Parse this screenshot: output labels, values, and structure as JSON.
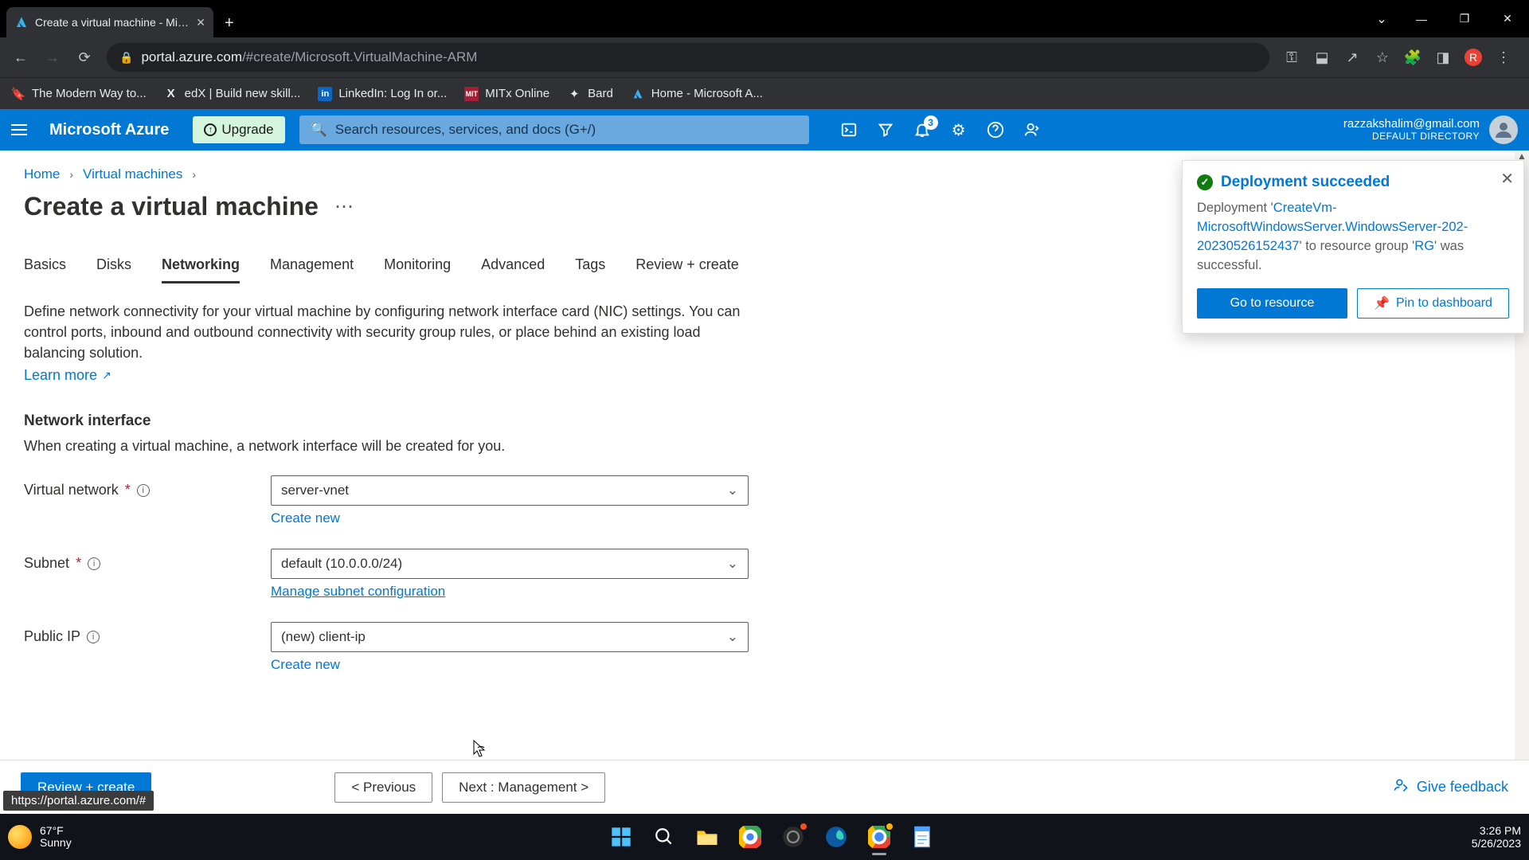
{
  "browser": {
    "tab_title": "Create a virtual machine - Micros",
    "url_host": "portal.azure.com",
    "url_path": "/#create/Microsoft.VirtualMachine-ARM",
    "bookmarks": [
      {
        "label": "The Modern Way to..."
      },
      {
        "label": "edX | Build new skill..."
      },
      {
        "label": "LinkedIn: Log In or..."
      },
      {
        "label": "MITx Online"
      },
      {
        "label": "Bard"
      },
      {
        "label": "Home - Microsoft A..."
      }
    ],
    "status_url": "https://portal.azure.com/#"
  },
  "azure_header": {
    "brand": "Microsoft Azure",
    "upgrade_label": "Upgrade",
    "search_placeholder": "Search resources, services, and docs (G+/)",
    "notification_count": "3",
    "account_email": "razzakshalim@gmail.com",
    "account_directory": "DEFAULT DIRECTORY"
  },
  "breadcrumb": {
    "items": [
      "Home",
      "Virtual machines"
    ]
  },
  "page": {
    "title": "Create a virtual machine",
    "tabs": [
      "Basics",
      "Disks",
      "Networking",
      "Management",
      "Monitoring",
      "Advanced",
      "Tags",
      "Review + create"
    ],
    "active_tab_index": 2,
    "intro_text": "Define network connectivity for your virtual machine by configuring network interface card (NIC) settings. You can control ports, inbound and outbound connectivity with security group rules, or place behind an existing load balancing solution.",
    "learn_more": "Learn more",
    "section_heading": "Network interface",
    "section_sub": "When creating a virtual machine, a network interface will be created for you.",
    "fields": {
      "vnet": {
        "label": "Virtual network",
        "required": true,
        "value": "server-vnet",
        "sublink": "Create new"
      },
      "subnet": {
        "label": "Subnet",
        "required": true,
        "value": "default (10.0.0.0/24)",
        "sublink": "Manage subnet configuration"
      },
      "publicip": {
        "label": "Public IP",
        "required": false,
        "value": "(new) client-ip",
        "sublink": "Create new"
      }
    }
  },
  "footer": {
    "review_label": "Review + create",
    "prev_label": "< Previous",
    "next_label": "Next : Management >",
    "feedback_label": "Give feedback"
  },
  "toast": {
    "title": "Deployment succeeded",
    "prefix": "Deployment '",
    "link1": "CreateVm-MicrosoftWindowsServer.WindowsServer-202-20230526152437",
    "mid1": "' to resource group '",
    "link2": "RG",
    "suffix": "' was successful.",
    "primary_btn": "Go to resource",
    "secondary_btn": "Pin to dashboard"
  },
  "taskbar": {
    "temp": "67°F",
    "condition": "Sunny",
    "time": "3:26 PM",
    "date": "5/26/2023"
  }
}
